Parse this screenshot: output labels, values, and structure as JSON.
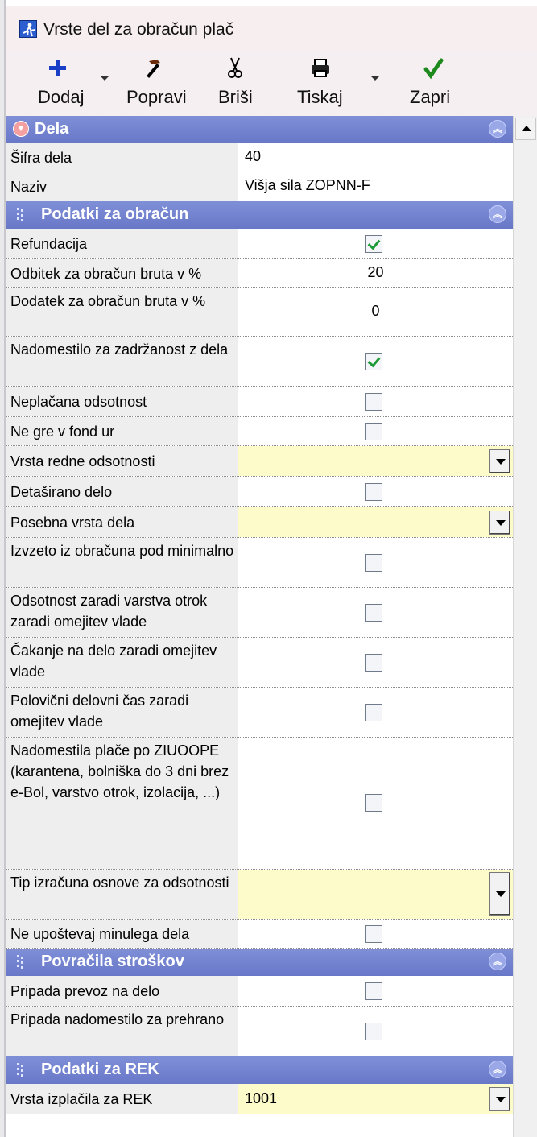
{
  "window": {
    "title": "Vrste del za obračun plač"
  },
  "toolbar": {
    "add_label": "Dodaj",
    "edit_label": "Popravi",
    "delete_label": "Briši",
    "print_label": "Tiskaj",
    "close_label": "Zapri"
  },
  "sections": {
    "dela": "Dela",
    "podatki": "Podatki za obračun",
    "povracila": "Povračila stroškov",
    "rek": "Podatki za REK"
  },
  "rows": {
    "sifra": {
      "label": "Šifra dela",
      "value": "40"
    },
    "naziv": {
      "label": "Naziv",
      "value": "Višja sila ZOPNN-F"
    },
    "refundacija": {
      "label": "Refundacija",
      "checked": true
    },
    "odbitek": {
      "label": "Odbitek za obračun bruta v %",
      "value": "20"
    },
    "dodatek": {
      "label": "Dodatek za obračun bruta v %",
      "value": "0"
    },
    "nadomestilo_zadrzanost": {
      "label": "Nadomestilo za zadržanost z dela",
      "checked": true
    },
    "neplacana": {
      "label": "Neplačana odsotnost",
      "checked": false
    },
    "fond_ur": {
      "label": "Ne gre v fond ur",
      "checked": false
    },
    "vrsta_redne": {
      "label": "Vrsta redne odsotnosti",
      "value": ""
    },
    "detasirano": {
      "label": "Detaširano delo",
      "checked": false
    },
    "posebna_vrsta": {
      "label": "Posebna vrsta dela",
      "value": ""
    },
    "izvzeto": {
      "label": "Izvzeto iz obračuna pod minimalno",
      "checked": false
    },
    "varstvo": {
      "label": "Odsotnost zaradi varstva otrok zaradi omejitev vlade",
      "checked": false
    },
    "cakanje": {
      "label": "Čakanje na delo zaradi omejitev vlade",
      "checked": false
    },
    "polovicni": {
      "label": "Polovični delovni čas zaradi omejitev vlade",
      "checked": false
    },
    "ziuoope": {
      "label": "Nadomestila plače po ZIUOOPE (karantena, bolniška do 3 dni brez e-Bol, varstvo otrok, izolacija, ...)",
      "checked": false
    },
    "tip_izracuna": {
      "label": "Tip izračuna osnove za odsotnosti",
      "value": ""
    },
    "minulo_delo": {
      "label": "Ne upoštevaj minulega dela",
      "checked": false
    },
    "prevoz": {
      "label": "Pripada prevoz na delo",
      "checked": false
    },
    "prehrana": {
      "label": "Pripada nadomestilo za prehrano",
      "checked": false
    },
    "rek_vrsta": {
      "label": "Vrsta izplačila za REK",
      "value": "1001"
    }
  }
}
